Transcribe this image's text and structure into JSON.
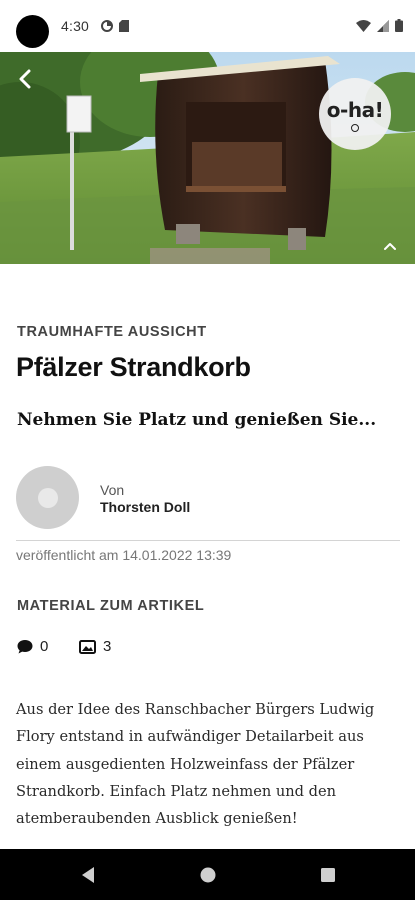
{
  "status_bar": {
    "time": "4:30",
    "left_icons": [
      "data-saver-icon",
      "sd-card-icon"
    ],
    "right_icons": [
      "wifi-icon",
      "cell-signal-icon",
      "battery-icon"
    ]
  },
  "hero": {
    "image_subject": "wooden wine barrel beach chair on a meadow",
    "brand_logo_text": "o-ha!"
  },
  "article": {
    "kicker": "TRAUMHAFTE AUSSICHT",
    "title": "Pfälzer Strandkorb",
    "teaser": "Nehmen Sie Platz und genießen Sie...",
    "author": {
      "by_label": "Von",
      "name": "Thorsten Doll"
    },
    "published": "veröffentlicht am 14.01.2022 13:39",
    "material": {
      "heading": "MATERIAL ZUM ARTIKEL",
      "comments_count": "0",
      "images_count": "3"
    },
    "body": "Aus der Idee des Ranschbacher Bürgers Ludwig Flory entstand in aufwändiger Detailarbeit aus einem ausgedienten Holzweinfass der Pfälzer Strandkorb. Einfach Platz nehmen und den atemberaubenden Ausblick genießen!"
  },
  "colors": {
    "accent_text": "#111111",
    "muted_text": "#777777",
    "nav_background": "#000000"
  }
}
